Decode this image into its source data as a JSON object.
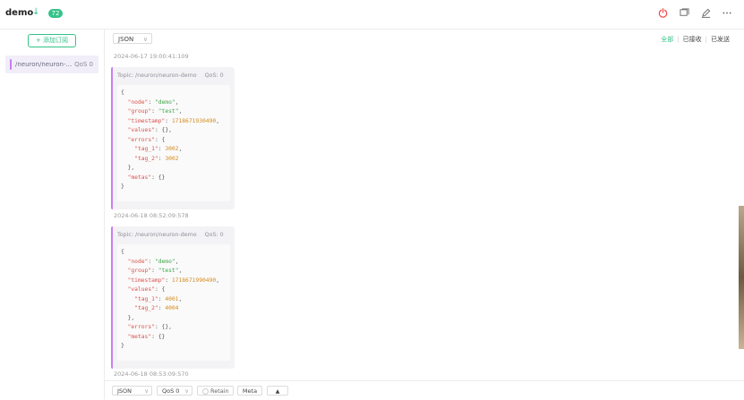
{
  "header": {
    "connection_name": "demo",
    "message_count": "72"
  },
  "icons": {
    "disconnect": "power-icon",
    "new_window": "window-icon",
    "edit": "edit-icon",
    "more": "more-icon",
    "chevron": "double-chevron-icon"
  },
  "sidebar": {
    "add_subscription_label": "+ 添加订阅",
    "subscriptions": [
      {
        "topic": "/neuron/neuron-...",
        "qos": "QoS 0",
        "color": "#c77ff2"
      }
    ]
  },
  "toolbar": {
    "format": "JSON",
    "filters": {
      "all": "全部",
      "received": "已接收",
      "sent": "已发送"
    }
  },
  "messages": [
    {
      "timestamp": "2024-06-17 19:00:41:109",
      "topic": "Topic: /neuron/neuron-demo",
      "qos": "QoS: 0",
      "lines": [
        {
          "t": "{"
        },
        {
          "i": 2,
          "k": "\"node\"",
          "v": "\"demo\"",
          "vt": "s",
          "e": ","
        },
        {
          "i": 2,
          "k": "\"group\"",
          "v": "\"test\"",
          "vt": "s",
          "e": ","
        },
        {
          "i": 2,
          "k": "\"timestamp\"",
          "v": "1718671930490",
          "vt": "n",
          "e": ","
        },
        {
          "i": 2,
          "k": "\"values\"",
          "v": "{}",
          "vt": "p",
          "e": ","
        },
        {
          "i": 2,
          "k": "\"errors\"",
          "v": "{",
          "vt": "p",
          "e": ""
        },
        {
          "i": 4,
          "k": "\"tag_1\"",
          "v": "3002",
          "vt": "n",
          "e": ","
        },
        {
          "i": 4,
          "k": "\"tag_2\"",
          "v": "3002",
          "vt": "n",
          "e": ""
        },
        {
          "i": 2,
          "t": "},"
        },
        {
          "i": 2,
          "k": "\"metas\"",
          "v": "{}",
          "vt": "p",
          "e": ""
        },
        {
          "t": "}"
        }
      ]
    },
    {
      "timestamp": "2024-06-18 08:52:09:578",
      "topic": "Topic: /neuron/neuron-demo",
      "qos": "QoS: 0",
      "lines": [
        {
          "t": "{"
        },
        {
          "i": 2,
          "k": "\"node\"",
          "v": "\"demo\"",
          "vt": "s",
          "e": ","
        },
        {
          "i": 2,
          "k": "\"group\"",
          "v": "\"test\"",
          "vt": "s",
          "e": ","
        },
        {
          "i": 2,
          "k": "\"timestamp\"",
          "v": "1718671990490",
          "vt": "n",
          "e": ","
        },
        {
          "i": 2,
          "k": "\"values\"",
          "v": "{",
          "vt": "p",
          "e": ""
        },
        {
          "i": 4,
          "k": "\"tag_1\"",
          "v": "4001",
          "vt": "n",
          "e": ","
        },
        {
          "i": 4,
          "k": "\"tag_2\"",
          "v": "4004",
          "vt": "n",
          "e": ""
        },
        {
          "i": 2,
          "t": "},"
        },
        {
          "i": 2,
          "k": "\"errors\"",
          "v": "{}",
          "vt": "p",
          "e": ","
        },
        {
          "i": 2,
          "k": "\"metas\"",
          "v": "{}",
          "vt": "p",
          "e": ""
        },
        {
          "t": "}"
        }
      ]
    }
  ],
  "last_timestamp": "2024-06-18 08:53:09:570",
  "bottom_bar": {
    "format": "JSON",
    "qos": "QoS 0",
    "retain_label": "Retain",
    "meta_label": "Meta"
  },
  "colors": {
    "accent": "#34c388",
    "subscription": "#c77ff2",
    "disconnect": "#f04c4c"
  }
}
